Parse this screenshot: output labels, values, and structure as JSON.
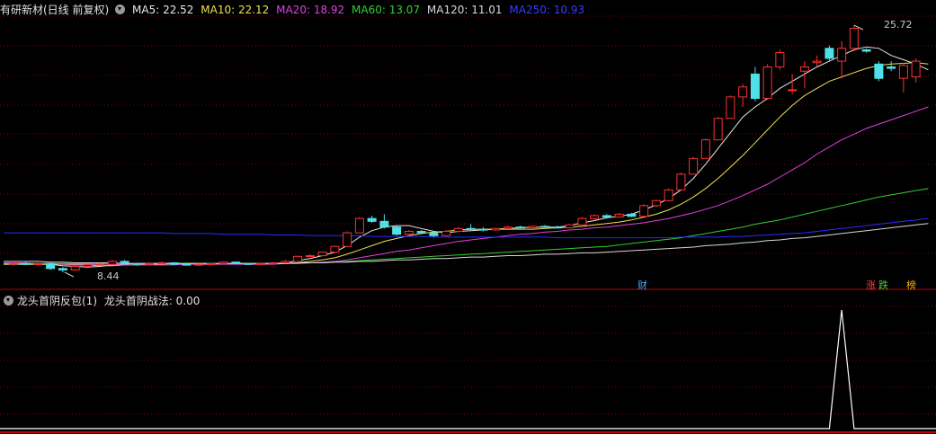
{
  "main_panel": {
    "title": "有研新材(日线 前复权)",
    "ma_legend": [
      {
        "label": "MA5: 22.52",
        "color": "#e8e8e8"
      },
      {
        "label": "MA10: 22.12",
        "color": "#f0e050"
      },
      {
        "label": "MA20: 18.92",
        "color": "#e040e0"
      },
      {
        "label": "MA60: 13.07",
        "color": "#30d030"
      },
      {
        "label": "MA120: 11.01",
        "color": "#d8d8d8"
      },
      {
        "label": "MA250: 10.93",
        "color": "#2a2aff"
      }
    ],
    "high_label": "25.72",
    "low_label": "8.44",
    "markers": [
      {
        "text": "财",
        "color": "#4aa8ff"
      },
      {
        "text": "涨",
        "color": "#ff4040"
      },
      {
        "text": "跌",
        "color": "#40d040"
      },
      {
        "text": "榜",
        "color": "#ffb000"
      }
    ]
  },
  "indicator_panel": {
    "title": "龙头首阴反包(1)",
    "value_label": "龙头首阴战法: 0.00"
  },
  "colors": {
    "background": "#000000",
    "grid": "#8b0000",
    "up_candle": "#ff3030",
    "down_candle": "#50e0e8",
    "panel_border": "#c00000"
  },
  "chart_data": {
    "type": "candlestick",
    "price_range": [
      8.44,
      25.72
    ],
    "candles": [
      {
        "o": 9.0,
        "h": 9.1,
        "l": 8.9,
        "c": 9.05
      },
      {
        "o": 9.05,
        "h": 9.15,
        "l": 8.95,
        "c": 9.0
      },
      {
        "o": 9.0,
        "h": 9.1,
        "l": 8.9,
        "c": 9.05
      },
      {
        "o": 9.05,
        "h": 9.1,
        "l": 8.6,
        "c": 8.7
      },
      {
        "o": 8.7,
        "h": 8.8,
        "l": 8.44,
        "c": 8.6
      },
      {
        "o": 8.6,
        "h": 8.9,
        "l": 8.55,
        "c": 8.85
      },
      {
        "o": 8.85,
        "h": 9.0,
        "l": 8.8,
        "c": 8.95
      },
      {
        "o": 8.95,
        "h": 9.1,
        "l": 8.9,
        "c": 9.0
      },
      {
        "o": 9.0,
        "h": 9.3,
        "l": 8.95,
        "c": 9.2
      },
      {
        "o": 9.2,
        "h": 9.3,
        "l": 9.0,
        "c": 9.05
      },
      {
        "o": 9.05,
        "h": 9.1,
        "l": 8.9,
        "c": 9.0
      },
      {
        "o": 9.0,
        "h": 9.1,
        "l": 8.95,
        "c": 9.05
      },
      {
        "o": 9.05,
        "h": 9.2,
        "l": 9.0,
        "c": 9.1
      },
      {
        "o": 9.1,
        "h": 9.15,
        "l": 8.95,
        "c": 9.0
      },
      {
        "o": 9.0,
        "h": 9.1,
        "l": 8.9,
        "c": 8.95
      },
      {
        "o": 8.95,
        "h": 9.05,
        "l": 8.9,
        "c": 9.0
      },
      {
        "o": 9.0,
        "h": 9.1,
        "l": 8.95,
        "c": 9.05
      },
      {
        "o": 9.05,
        "h": 9.2,
        "l": 9.0,
        "c": 9.15
      },
      {
        "o": 9.15,
        "h": 9.2,
        "l": 9.0,
        "c": 9.05
      },
      {
        "o": 9.05,
        "h": 9.1,
        "l": 8.95,
        "c": 9.0
      },
      {
        "o": 9.0,
        "h": 9.1,
        "l": 8.95,
        "c": 9.05
      },
      {
        "o": 9.05,
        "h": 9.15,
        "l": 9.0,
        "c": 9.1
      },
      {
        "o": 9.1,
        "h": 9.3,
        "l": 9.05,
        "c": 9.2
      },
      {
        "o": 9.2,
        "h": 9.6,
        "l": 9.15,
        "c": 9.55
      },
      {
        "o": 9.55,
        "h": 9.7,
        "l": 9.5,
        "c": 9.6
      },
      {
        "o": 9.6,
        "h": 9.9,
        "l": 9.55,
        "c": 9.85
      },
      {
        "o": 9.85,
        "h": 10.3,
        "l": 9.8,
        "c": 10.25
      },
      {
        "o": 10.25,
        "h": 11.3,
        "l": 10.2,
        "c": 11.2
      },
      {
        "o": 11.2,
        "h": 12.3,
        "l": 11.2,
        "c": 12.2
      },
      {
        "o": 12.2,
        "h": 12.4,
        "l": 11.9,
        "c": 12.0
      },
      {
        "o": 12.0,
        "h": 12.5,
        "l": 11.5,
        "c": 11.6
      },
      {
        "o": 11.6,
        "h": 11.7,
        "l": 11.0,
        "c": 11.1
      },
      {
        "o": 11.1,
        "h": 11.4,
        "l": 11.0,
        "c": 11.3
      },
      {
        "o": 11.3,
        "h": 11.4,
        "l": 11.1,
        "c": 11.2
      },
      {
        "o": 11.2,
        "h": 11.3,
        "l": 10.9,
        "c": 11.0
      },
      {
        "o": 11.0,
        "h": 11.4,
        "l": 10.95,
        "c": 11.3
      },
      {
        "o": 11.3,
        "h": 11.6,
        "l": 11.25,
        "c": 11.5
      },
      {
        "o": 11.5,
        "h": 11.8,
        "l": 11.4,
        "c": 11.45
      },
      {
        "o": 11.45,
        "h": 11.6,
        "l": 11.3,
        "c": 11.4
      },
      {
        "o": 11.4,
        "h": 11.55,
        "l": 11.35,
        "c": 11.5
      },
      {
        "o": 11.5,
        "h": 11.7,
        "l": 11.45,
        "c": 11.6
      },
      {
        "o": 11.6,
        "h": 11.7,
        "l": 11.5,
        "c": 11.55
      },
      {
        "o": 11.55,
        "h": 11.7,
        "l": 11.5,
        "c": 11.65
      },
      {
        "o": 11.65,
        "h": 11.75,
        "l": 11.55,
        "c": 11.6
      },
      {
        "o": 11.6,
        "h": 11.7,
        "l": 11.5,
        "c": 11.55
      },
      {
        "o": 11.55,
        "h": 11.8,
        "l": 11.5,
        "c": 11.75
      },
      {
        "o": 11.75,
        "h": 12.3,
        "l": 11.7,
        "c": 12.2
      },
      {
        "o": 12.2,
        "h": 12.5,
        "l": 12.1,
        "c": 12.4
      },
      {
        "o": 12.4,
        "h": 12.5,
        "l": 12.2,
        "c": 12.3
      },
      {
        "o": 12.3,
        "h": 12.6,
        "l": 12.25,
        "c": 12.5
      },
      {
        "o": 12.5,
        "h": 12.6,
        "l": 12.3,
        "c": 12.35
      },
      {
        "o": 12.35,
        "h": 13.2,
        "l": 12.3,
        "c": 13.1
      },
      {
        "o": 13.1,
        "h": 13.5,
        "l": 13.0,
        "c": 13.45
      },
      {
        "o": 13.45,
        "h": 14.3,
        "l": 13.4,
        "c": 14.2
      },
      {
        "o": 14.2,
        "h": 15.4,
        "l": 14.2,
        "c": 15.3
      },
      {
        "o": 15.3,
        "h": 16.5,
        "l": 15.3,
        "c": 16.4
      },
      {
        "o": 16.4,
        "h": 17.8,
        "l": 16.4,
        "c": 17.7
      },
      {
        "o": 17.7,
        "h": 19.3,
        "l": 17.7,
        "c": 19.2
      },
      {
        "o": 19.2,
        "h": 20.8,
        "l": 19.2,
        "c": 20.7
      },
      {
        "o": 20.7,
        "h": 21.6,
        "l": 20.0,
        "c": 21.4
      },
      {
        "o": 22.3,
        "h": 22.8,
        "l": 20.4,
        "c": 20.6
      },
      {
        "o": 20.6,
        "h": 23.0,
        "l": 20.5,
        "c": 22.8
      },
      {
        "o": 22.8,
        "h": 24.0,
        "l": 22.6,
        "c": 23.8
      },
      {
        "o": 21.2,
        "h": 22.3,
        "l": 20.9,
        "c": 21.2
      },
      {
        "o": 22.5,
        "h": 23.2,
        "l": 21.3,
        "c": 22.8
      },
      {
        "o": 23.1,
        "h": 23.6,
        "l": 22.8,
        "c": 23.2
      },
      {
        "o": 24.1,
        "h": 24.3,
        "l": 23.2,
        "c": 23.4
      },
      {
        "o": 23.2,
        "h": 24.6,
        "l": 22.0,
        "c": 24.1
      },
      {
        "o": 24.1,
        "h": 25.72,
        "l": 23.9,
        "c": 25.5
      },
      {
        "o": 24.0,
        "h": 24.1,
        "l": 23.8,
        "c": 23.9
      },
      {
        "o": 23.0,
        "h": 23.2,
        "l": 21.8,
        "c": 22.0
      },
      {
        "o": 22.8,
        "h": 23.2,
        "l": 22.5,
        "c": 22.7
      },
      {
        "o": 22.0,
        "h": 23.1,
        "l": 21.0,
        "c": 22.9
      },
      {
        "o": 22.1,
        "h": 23.4,
        "l": 21.7,
        "c": 23.2
      }
    ],
    "ma_lines": [
      {
        "name": "MA5",
        "color": "#e8e8e8",
        "values": [
          9.0,
          9.0,
          9.0,
          9.0,
          8.9,
          8.85,
          8.8,
          8.85,
          8.95,
          9.0,
          9.05,
          9.05,
          9.05,
          9.05,
          9.05,
          9.0,
          9.0,
          9.05,
          9.05,
          9.05,
          9.05,
          9.05,
          9.1,
          9.25,
          9.4,
          9.6,
          9.85,
          10.3,
          10.9,
          11.35,
          11.6,
          11.7,
          11.7,
          11.5,
          11.3,
          11.2,
          11.3,
          11.35,
          11.4,
          11.45,
          11.5,
          11.55,
          11.6,
          11.6,
          11.6,
          11.7,
          11.9,
          12.05,
          12.25,
          12.35,
          12.5,
          12.8,
          13.15,
          13.6,
          14.2,
          15.0,
          16.0,
          17.1,
          18.2,
          19.3,
          20.0,
          20.6,
          21.3,
          21.8,
          22.3,
          22.8,
          23.2,
          23.6,
          24.0,
          24.2,
          24.1,
          23.6,
          23.3,
          23.0,
          22.6
        ]
      },
      {
        "name": "MA10",
        "color": "#f0e050",
        "values": [
          9.0,
          9.0,
          9.0,
          9.0,
          9.0,
          8.95,
          8.95,
          8.9,
          8.9,
          8.95,
          8.95,
          9.0,
          9.0,
          9.05,
          9.05,
          9.05,
          9.05,
          9.05,
          9.05,
          9.05,
          9.05,
          9.05,
          9.05,
          9.1,
          9.2,
          9.3,
          9.45,
          9.7,
          10.0,
          10.3,
          10.6,
          10.8,
          11.0,
          11.15,
          11.25,
          11.3,
          11.4,
          11.45,
          11.45,
          11.45,
          11.45,
          11.45,
          11.45,
          11.5,
          11.55,
          11.6,
          11.65,
          11.75,
          11.85,
          11.95,
          12.1,
          12.3,
          12.5,
          12.8,
          13.2,
          13.7,
          14.3,
          15.0,
          15.8,
          16.6,
          17.5,
          18.4,
          19.3,
          20.1,
          20.8,
          21.3,
          21.8,
          22.1,
          22.4,
          22.7,
          22.9,
          23.0,
          23.05,
          23.1,
          23.0
        ]
      },
      {
        "name": "MA20",
        "color": "#e040e0",
        "values": [
          9.1,
          9.1,
          9.05,
          9.05,
          9.0,
          9.0,
          9.0,
          8.95,
          8.95,
          8.95,
          8.95,
          8.95,
          8.95,
          8.95,
          9.0,
          9.0,
          9.0,
          9.0,
          9.0,
          9.0,
          9.0,
          9.0,
          9.05,
          9.05,
          9.1,
          9.15,
          9.2,
          9.3,
          9.45,
          9.6,
          9.75,
          9.9,
          10.0,
          10.15,
          10.3,
          10.45,
          10.6,
          10.7,
          10.8,
          10.9,
          11.0,
          11.1,
          11.15,
          11.25,
          11.3,
          11.4,
          11.45,
          11.55,
          11.6,
          11.7,
          11.8,
          11.9,
          12.05,
          12.2,
          12.4,
          12.6,
          12.85,
          13.1,
          13.45,
          13.8,
          14.2,
          14.6,
          15.1,
          15.6,
          16.1,
          16.7,
          17.2,
          17.7,
          18.1,
          18.5,
          18.8,
          19.1,
          19.4,
          19.7,
          20.0
        ]
      },
      {
        "name": "MA60",
        "color": "#30d030",
        "values": [
          9.05,
          9.05,
          9.05,
          9.05,
          9.05,
          9.05,
          9.05,
          9.05,
          9.05,
          9.05,
          9.05,
          9.05,
          9.05,
          9.05,
          9.05,
          9.05,
          9.05,
          9.05,
          9.05,
          9.05,
          9.05,
          9.05,
          9.05,
          9.05,
          9.1,
          9.1,
          9.15,
          9.2,
          9.25,
          9.3,
          9.35,
          9.4,
          9.45,
          9.5,
          9.55,
          9.6,
          9.65,
          9.7,
          9.75,
          9.8,
          9.85,
          9.9,
          9.95,
          10.0,
          10.05,
          10.1,
          10.15,
          10.2,
          10.25,
          10.35,
          10.45,
          10.55,
          10.65,
          10.75,
          10.85,
          11.0,
          11.15,
          11.3,
          11.45,
          11.6,
          11.8,
          11.95,
          12.1,
          12.3,
          12.5,
          12.7,
          12.9,
          13.1,
          13.3,
          13.5,
          13.7,
          13.85,
          14.0,
          14.15,
          14.3
        ]
      },
      {
        "name": "MA120",
        "color": "#d8d8d8",
        "values": [
          9.2,
          9.2,
          9.2,
          9.15,
          9.15,
          9.1,
          9.1,
          9.1,
          9.1,
          9.05,
          9.05,
          9.05,
          9.05,
          9.05,
          9.05,
          9.05,
          9.05,
          9.05,
          9.05,
          9.05,
          9.05,
          9.05,
          9.05,
          9.1,
          9.1,
          9.1,
          9.15,
          9.15,
          9.2,
          9.2,
          9.25,
          9.3,
          9.3,
          9.35,
          9.4,
          9.4,
          9.45,
          9.5,
          9.5,
          9.55,
          9.6,
          9.6,
          9.65,
          9.7,
          9.7,
          9.75,
          9.8,
          9.8,
          9.85,
          9.9,
          9.95,
          10.0,
          10.05,
          10.1,
          10.15,
          10.2,
          10.3,
          10.35,
          10.4,
          10.5,
          10.55,
          10.65,
          10.7,
          10.8,
          10.85,
          10.95,
          11.05,
          11.15,
          11.25,
          11.35,
          11.45,
          11.55,
          11.65,
          11.75,
          11.85
        ]
      },
      {
        "name": "MA250",
        "color": "#2a2aff",
        "values": [
          11.2,
          11.2,
          11.2,
          11.2,
          11.2,
          11.2,
          11.2,
          11.2,
          11.2,
          11.2,
          11.2,
          11.2,
          11.2,
          11.15,
          11.15,
          11.15,
          11.15,
          11.1,
          11.1,
          11.1,
          11.1,
          11.05,
          11.05,
          11.05,
          11.0,
          11.0,
          11.0,
          11.0,
          11.0,
          10.95,
          10.95,
          10.95,
          10.95,
          10.95,
          10.9,
          10.9,
          10.9,
          10.9,
          10.9,
          10.9,
          10.9,
          10.9,
          10.9,
          10.9,
          10.85,
          10.85,
          10.85,
          10.85,
          10.85,
          10.85,
          10.85,
          10.85,
          10.85,
          10.85,
          10.9,
          10.9,
          10.9,
          10.9,
          10.95,
          10.95,
          11.0,
          11.05,
          11.1,
          11.15,
          11.2,
          11.3,
          11.4,
          11.5,
          11.6,
          11.7,
          11.8,
          11.9,
          12.0,
          12.1,
          12.2
        ]
      }
    ],
    "indicator": {
      "name": "龙头首阴战法",
      "values": [
        0,
        0,
        0,
        0,
        0,
        0,
        0,
        0,
        0,
        0,
        0,
        0,
        0,
        0,
        0,
        0,
        0,
        0,
        0,
        0,
        0,
        0,
        0,
        0,
        0,
        0,
        0,
        0,
        0,
        0,
        0,
        0,
        0,
        0,
        0,
        0,
        0,
        0,
        0,
        0,
        0,
        0,
        0,
        0,
        0,
        0,
        0,
        0,
        0,
        0,
        0,
        0,
        0,
        0,
        0,
        0,
        0,
        0,
        0,
        0,
        0,
        0,
        0,
        0,
        0,
        0,
        0,
        1,
        0,
        0,
        0,
        0,
        0,
        0,
        0
      ]
    }
  }
}
